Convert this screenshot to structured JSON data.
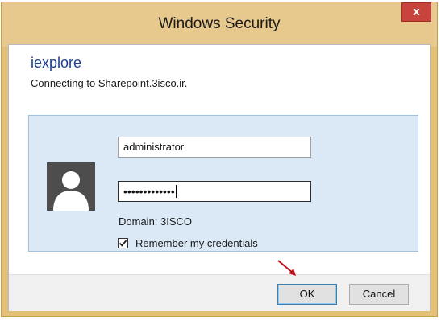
{
  "window": {
    "title": "Windows Security",
    "close_symbol": "x"
  },
  "header": {
    "app_name": "iexplore",
    "message": "Connecting to Sharepoint.3isco.ir."
  },
  "credentials": {
    "username_value": "administrator",
    "password_value": "•••••••••••••",
    "domain_text": "Domain: 3ISCO",
    "remember_label": "Remember my credentials",
    "remember_checked": true
  },
  "buttons": {
    "ok_label": "OK",
    "cancel_label": "Cancel"
  },
  "icons": {
    "avatar": "user-silhouette-icon",
    "close": "close-icon",
    "check": "check-icon",
    "annotation": "red-arrow-icon"
  },
  "colors": {
    "titlebar": "#e8c98d",
    "close_button": "#c7443c",
    "panel": "#dbe9f7",
    "app_name": "#1c3f8f",
    "annotation_arrow": "#c0121b"
  }
}
